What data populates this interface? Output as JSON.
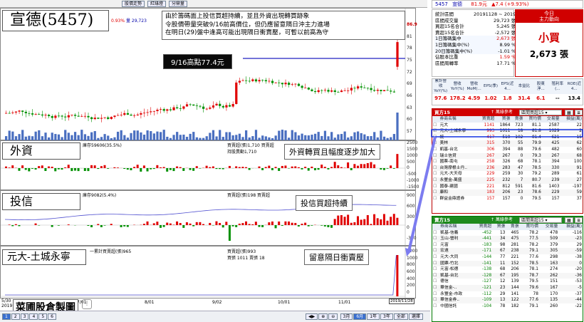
{
  "top": {
    "tabs": [
      "股價走勢",
      "紅綠燈",
      "分鼎量"
    ],
    "price_line": "量 29,723",
    "price_badge": "0.93%"
  },
  "banner": {
    "line1": "由於籌碼面上投信買超持續，並且外資出現轉買跡象",
    "line2": "令股價帶量突破9/16前高價位，但仍應留意隔日沖主力進場",
    "line3": "在明日(29)盤中逢高可能出現隔日衝賣壓，可暫以前高為守"
  },
  "pane1": {
    "title": "宣德(5457)",
    "annotation": "9/16高點77.4元",
    "yticks": [
      "86.9",
      "81",
      "78",
      "75",
      "72",
      "69",
      "66",
      "63",
      "60",
      "57"
    ]
  },
  "pane2": {
    "title": "外資",
    "legend_left": "庫存59606(35.5%)",
    "legend_mid": "買賣超(張)1,710 買賣超",
    "legend_mid2": "持股異動1,710",
    "annotation": "外資轉買且幅度逐步加大",
    "yticks": [
      "2500",
      "1500",
      "1000",
      "500",
      "0",
      "-500",
      "-1000",
      "-1500"
    ]
  },
  "pane3": {
    "title": "投信",
    "legend_left": "庫存9082(5.4%)",
    "legend_mid": "買賣超(張)198 買賣超",
    "annotation": "投信買超持續",
    "yticks": [
      "900",
      "600",
      "300",
      "0",
      "-300"
    ]
  },
  "pane4": {
    "title": "元大-土城永寧",
    "legend_left": "一累計買賣超(張)965",
    "legend_mid": "買賣超(張)993",
    "legend_mid2": "買張 1011 賣張 18",
    "annotation": "留意隔日衝賣壓",
    "yticks": [
      "1200",
      "1000",
      "800",
      "600",
      "400",
      "200",
      "0"
    ]
  },
  "xaxis": {
    "labels": [
      "5/30",
      "7/01",
      "8/01",
      "9/02",
      "10/01",
      "11/01"
    ],
    "year": "2019",
    "date_badge": "2019/11/28"
  },
  "footer": {
    "logo": "菜圃股倉製圖",
    "pages": [
      "1",
      "2",
      "3",
      "4",
      "5",
      "6"
    ],
    "periods": [
      "3月",
      "6月",
      "1年",
      "3年",
      "全部",
      "選擇"
    ]
  },
  "right": {
    "header": {
      "code": "5457",
      "name": "宣德",
      "price": "81.9元",
      "change": "▲7.4 (+9.93%)"
    },
    "stats": [
      {
        "label": "統計區間",
        "value": "20191128 ~ 2019"
      },
      {
        "label": "區間成交量",
        "value": "29,723 張"
      },
      {
        "label": "買超15名合計",
        "value": "5,245 張"
      },
      {
        "label": "賣超15名合計",
        "value": "-2,572 張"
      },
      {
        "label": "1日籌碼集中",
        "value": "2,673 張"
      },
      {
        "label": "1日籌碼集中(%)",
        "value": "8.99 %"
      },
      {
        "label": "20日籌碼集中(%)",
        "value": "-1.01 %"
      },
      {
        "label": "佔股本比重",
        "value": "1.59 %"
      },
      {
        "label": "區間周轉率",
        "value": "17.71 %"
      }
    ],
    "today_box": {
      "title": "今日",
      "subtitle": "主力動向",
      "action": "小買",
      "amount": "2,673 張"
    },
    "fund_headers": [
      "累計營收YoY(%)",
      "營收YoY(%)",
      "營收MoM(...",
      "EPS(季)",
      "EPS(近4...",
      "本益比",
      "股東淨...",
      "殖利率(...",
      "ROE(近4..."
    ],
    "fund_values": [
      "97.6",
      "178.28",
      "4.59",
      "1.02",
      "1.8",
      "31.4",
      "6.1",
      "--",
      "13.4"
    ],
    "buy_panel": {
      "title": "買方15",
      "source_label": "↑ 萬綠參考",
      "select": "區間買超15",
      "cols": [
        "券商名稱",
        "買賣超",
        "買張",
        "賣張",
        "買均價",
        "交易量",
        "損益(萬)"
      ],
      "rows": [
        [
          "元大",
          "1141",
          "1864",
          "723",
          "81.1",
          "2587",
          "22"
        ],
        [
          "元大-土城永寧",
          "993",
          "1011",
          "18",
          "81.8",
          "1029",
          "2"
        ],
        [
          "統一",
          "417",
          "519",
          "102",
          "81.4",
          "621",
          "15"
        ],
        [
          "美林",
          "315",
          "370",
          "55",
          "79.9",
          "425",
          "62"
        ],
        [
          "凱基-台北",
          "306",
          "394",
          "88",
          "79.6",
          "482",
          "60"
        ],
        [
          "瑞士信貸",
          "267",
          "267",
          "0",
          "79.3",
          "267",
          "68"
        ],
        [
          "國票-南屯",
          "258",
          "326",
          "68",
          "78.1",
          "394",
          "100"
        ],
        [
          "台灣摩根士丹..",
          "236",
          "283",
          "47",
          "78.5",
          "330",
          "91"
        ],
        [
          "元大-大天母",
          "229",
          "259",
          "30",
          "79.2",
          "289",
          "61"
        ],
        [
          "永豐金-萬盛",
          "225",
          "232",
          "7",
          "80.7",
          "239",
          "27"
        ],
        [
          "國泰-建國",
          "221",
          "812",
          "591",
          "81.6",
          "1403",
          "-197"
        ],
        [
          "康和",
          "183",
          "206",
          "23",
          "78.6",
          "229",
          "59"
        ],
        [
          "群益金鼎證券",
          "157",
          "157",
          "0",
          "79.5",
          "157",
          "37"
        ]
      ]
    },
    "sell_panel": {
      "title": "賣方15",
      "source_label": "↑ 萬綠參考",
      "select": "區間賣超15",
      "cols": [
        "券商名稱",
        "買賣超",
        "買張",
        "賣張",
        "賣均價",
        "交易量",
        "損益(萬)"
      ],
      "rows": [
        [
          "凱基-信義",
          "-452",
          "13",
          "465",
          "78.2",
          "478",
          "-116"
        ],
        [
          "玉山-營利",
          "-441",
          "34",
          "475",
          "77.5",
          "509",
          "-23"
        ],
        [
          "元富",
          "-183",
          "98",
          "281",
          "78.2",
          "379",
          "29"
        ],
        [
          "宏遠",
          "-171",
          "67",
          "238",
          "79.1",
          "305",
          "-59"
        ],
        [
          "元大-大同",
          "-144",
          "77",
          "221",
          "77.6",
          "298",
          "-38"
        ],
        [
          "國票-竹北",
          "-141",
          "11",
          "152",
          "78.5",
          "163",
          "0"
        ],
        [
          "元富-松德",
          "-138",
          "68",
          "206",
          "78.1",
          "274",
          "-20"
        ],
        [
          "凱基-台北",
          "-128",
          "67",
          "195",
          "78.7",
          "262",
          "-36"
        ],
        [
          "德信",
          "-127",
          "12",
          "139",
          "79.5",
          "151",
          "-53"
        ],
        [
          "華信金-..",
          "-121",
          "23",
          "144",
          "79.6",
          "167",
          "-5"
        ],
        [
          "永豐金-市政",
          "-112",
          "29",
          "141",
          "78",
          "170",
          "-37"
        ],
        [
          "華信金券..",
          "-109",
          "13",
          "122",
          "77.6",
          "135",
          "-44"
        ],
        [
          "中國信託",
          "-104",
          "78",
          "182",
          "79.1",
          "260",
          "-22"
        ]
      ]
    }
  }
}
